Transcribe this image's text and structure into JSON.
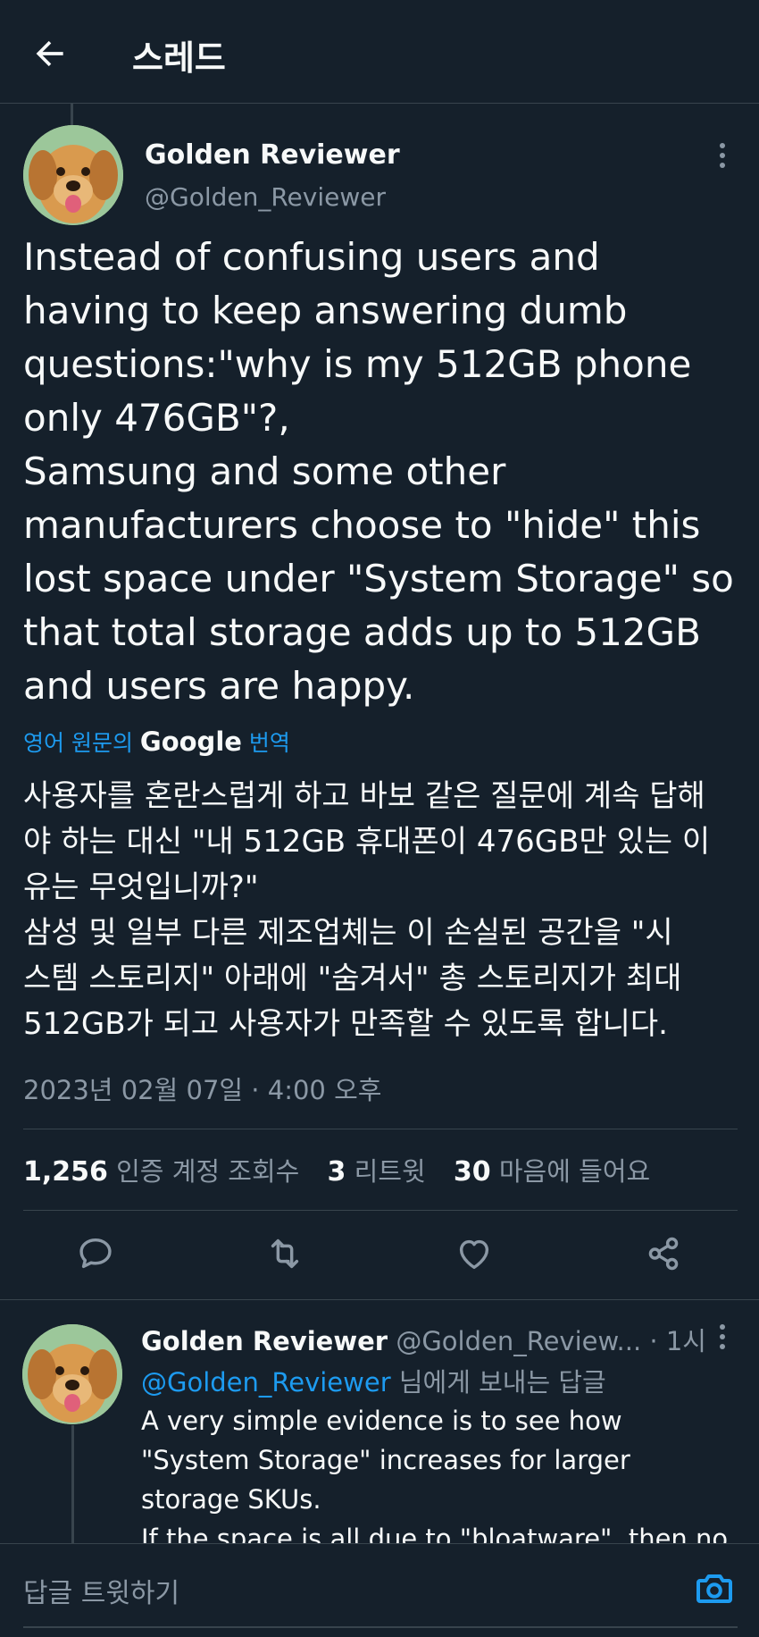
{
  "header": {
    "title": "스레드"
  },
  "tweet": {
    "author_name": "Golden Reviewer",
    "author_handle": "@Golden_Reviewer",
    "text": "Instead of confusing users and\nhaving to keep answering dumb\nquestions:\"why is my 512GB phone\nonly 476GB\"?,\nSamsung and some other\nmanufacturers choose to \"hide\" this\nlost space under \"System Storage\" so\nthat total storage adds up to 512GB\nand users are happy.",
    "translate_prefix": "영어 원문의",
    "translate_brand": "Google",
    "translate_suffix": "번역",
    "translated_text": "사용자를 혼란스럽게 하고 바보 같은 질문에 계속 답해\n야 하는 대신 \"내 512GB 휴대폰이 476GB만 있는 이\n유는 무엇입니까?\"\n삼성 및 일부 다른 제조업체는 이 손실된 공간을 \"시\n스템 스토리지\" 아래에 \"숨겨서\" 총 스토리지가 최대\n512GB가 되고 사용자가 만족할 수 있도록 합니다.",
    "timestamp": "2023년 02월 07일 · 4:00 오후",
    "stats": {
      "views_count": "1,256",
      "views_label": "인증 계정 조회수",
      "retweets_count": "3",
      "retweets_label": "리트윗",
      "likes_count": "30",
      "likes_label": "마음에 들어요"
    }
  },
  "reply": {
    "author_name": "Golden Reviewer",
    "author_handle": "@Golden_Review...",
    "time": "· 1시",
    "reply_to_mention": "@Golden_Reviewer",
    "reply_to_suffix": "님에게 보내는 답글",
    "text": "A very simple evidence is to see how\n\"System Storage\" increases for larger\nstorage SKUs.\nIf the space is all due to \"bloatware\", then no"
  },
  "compose": {
    "placeholder": "답글 트윗하기"
  },
  "colors": {
    "background": "#15202b",
    "text": "#f7f9f9",
    "secondary": "#8b98a5",
    "accent": "#1d9bf0",
    "divider": "#38444d"
  },
  "icons": {
    "back": "arrow-left-icon",
    "more": "more-vertical-icon",
    "reply": "comment-icon",
    "retweet": "retweet-icon",
    "like": "heart-icon",
    "share": "share-icon",
    "camera": "camera-icon"
  }
}
